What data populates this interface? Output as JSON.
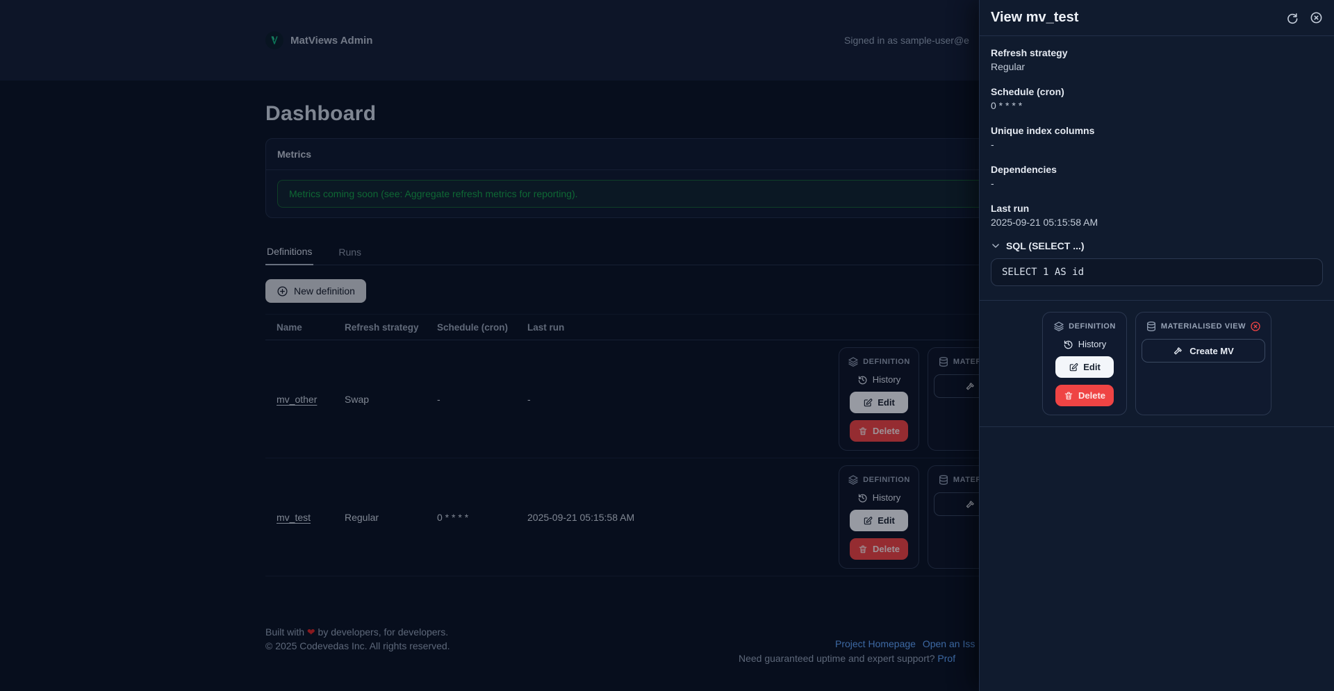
{
  "header": {
    "brand": "MatViews Admin",
    "signed_in": "Signed in as sample-user@e"
  },
  "page": {
    "title": "Dashboard"
  },
  "metrics": {
    "title": "Metrics",
    "notice": "Metrics coming soon (see: Aggregate refresh metrics for reporting)."
  },
  "tabs": {
    "definitions": "Definitions",
    "runs": "Runs"
  },
  "toolbar": {
    "new_definition": "New definition"
  },
  "table": {
    "headers": {
      "name": "Name",
      "refresh_strategy": "Refresh strategy",
      "schedule": "Schedule (cron)",
      "last_run": "Last run"
    },
    "rows": [
      {
        "name": "mv_other",
        "refresh_strategy": "Swap",
        "schedule": "-",
        "last_run": "-"
      },
      {
        "name": "mv_test",
        "refresh_strategy": "Regular",
        "schedule": "0 * * * *",
        "last_run": "2025-09-21 05:15:58 AM"
      }
    ]
  },
  "cards": {
    "definition": {
      "title": "DEFINITION",
      "history": "History",
      "edit": "Edit",
      "delete": "Delete"
    },
    "materialised": {
      "title": "MATERIALISED VIEW",
      "create": "Create MV"
    }
  },
  "drawer": {
    "title": "View mv_test",
    "fields": [
      {
        "label": "Refresh strategy",
        "value": "Regular"
      },
      {
        "label": "Schedule (cron)",
        "value": "0 * * * *"
      },
      {
        "label": "Unique index columns",
        "value": "-"
      },
      {
        "label": "Dependencies",
        "value": "-"
      },
      {
        "label": "Last run",
        "value": "2025-09-21 05:15:58 AM"
      }
    ],
    "sql": {
      "label": "SQL (SELECT ...)",
      "code": "SELECT 1 AS id"
    }
  },
  "footer": {
    "built_pre": "Built with",
    "heart": "❤",
    "built_post": "by developers, for developers.",
    "copyright": "© 2025 Codevedas Inc. All rights reserved.",
    "link_homepage": "Project Homepage",
    "link_issue": "Open an Iss",
    "support_text": "Need guaranteed uptime and expert support?",
    "support_link": "Prof"
  },
  "colors": {
    "accent_green": "#10b981",
    "danger": "#ef4444",
    "link": "#60a5fa",
    "edit_bg": "#f3f6fa"
  }
}
